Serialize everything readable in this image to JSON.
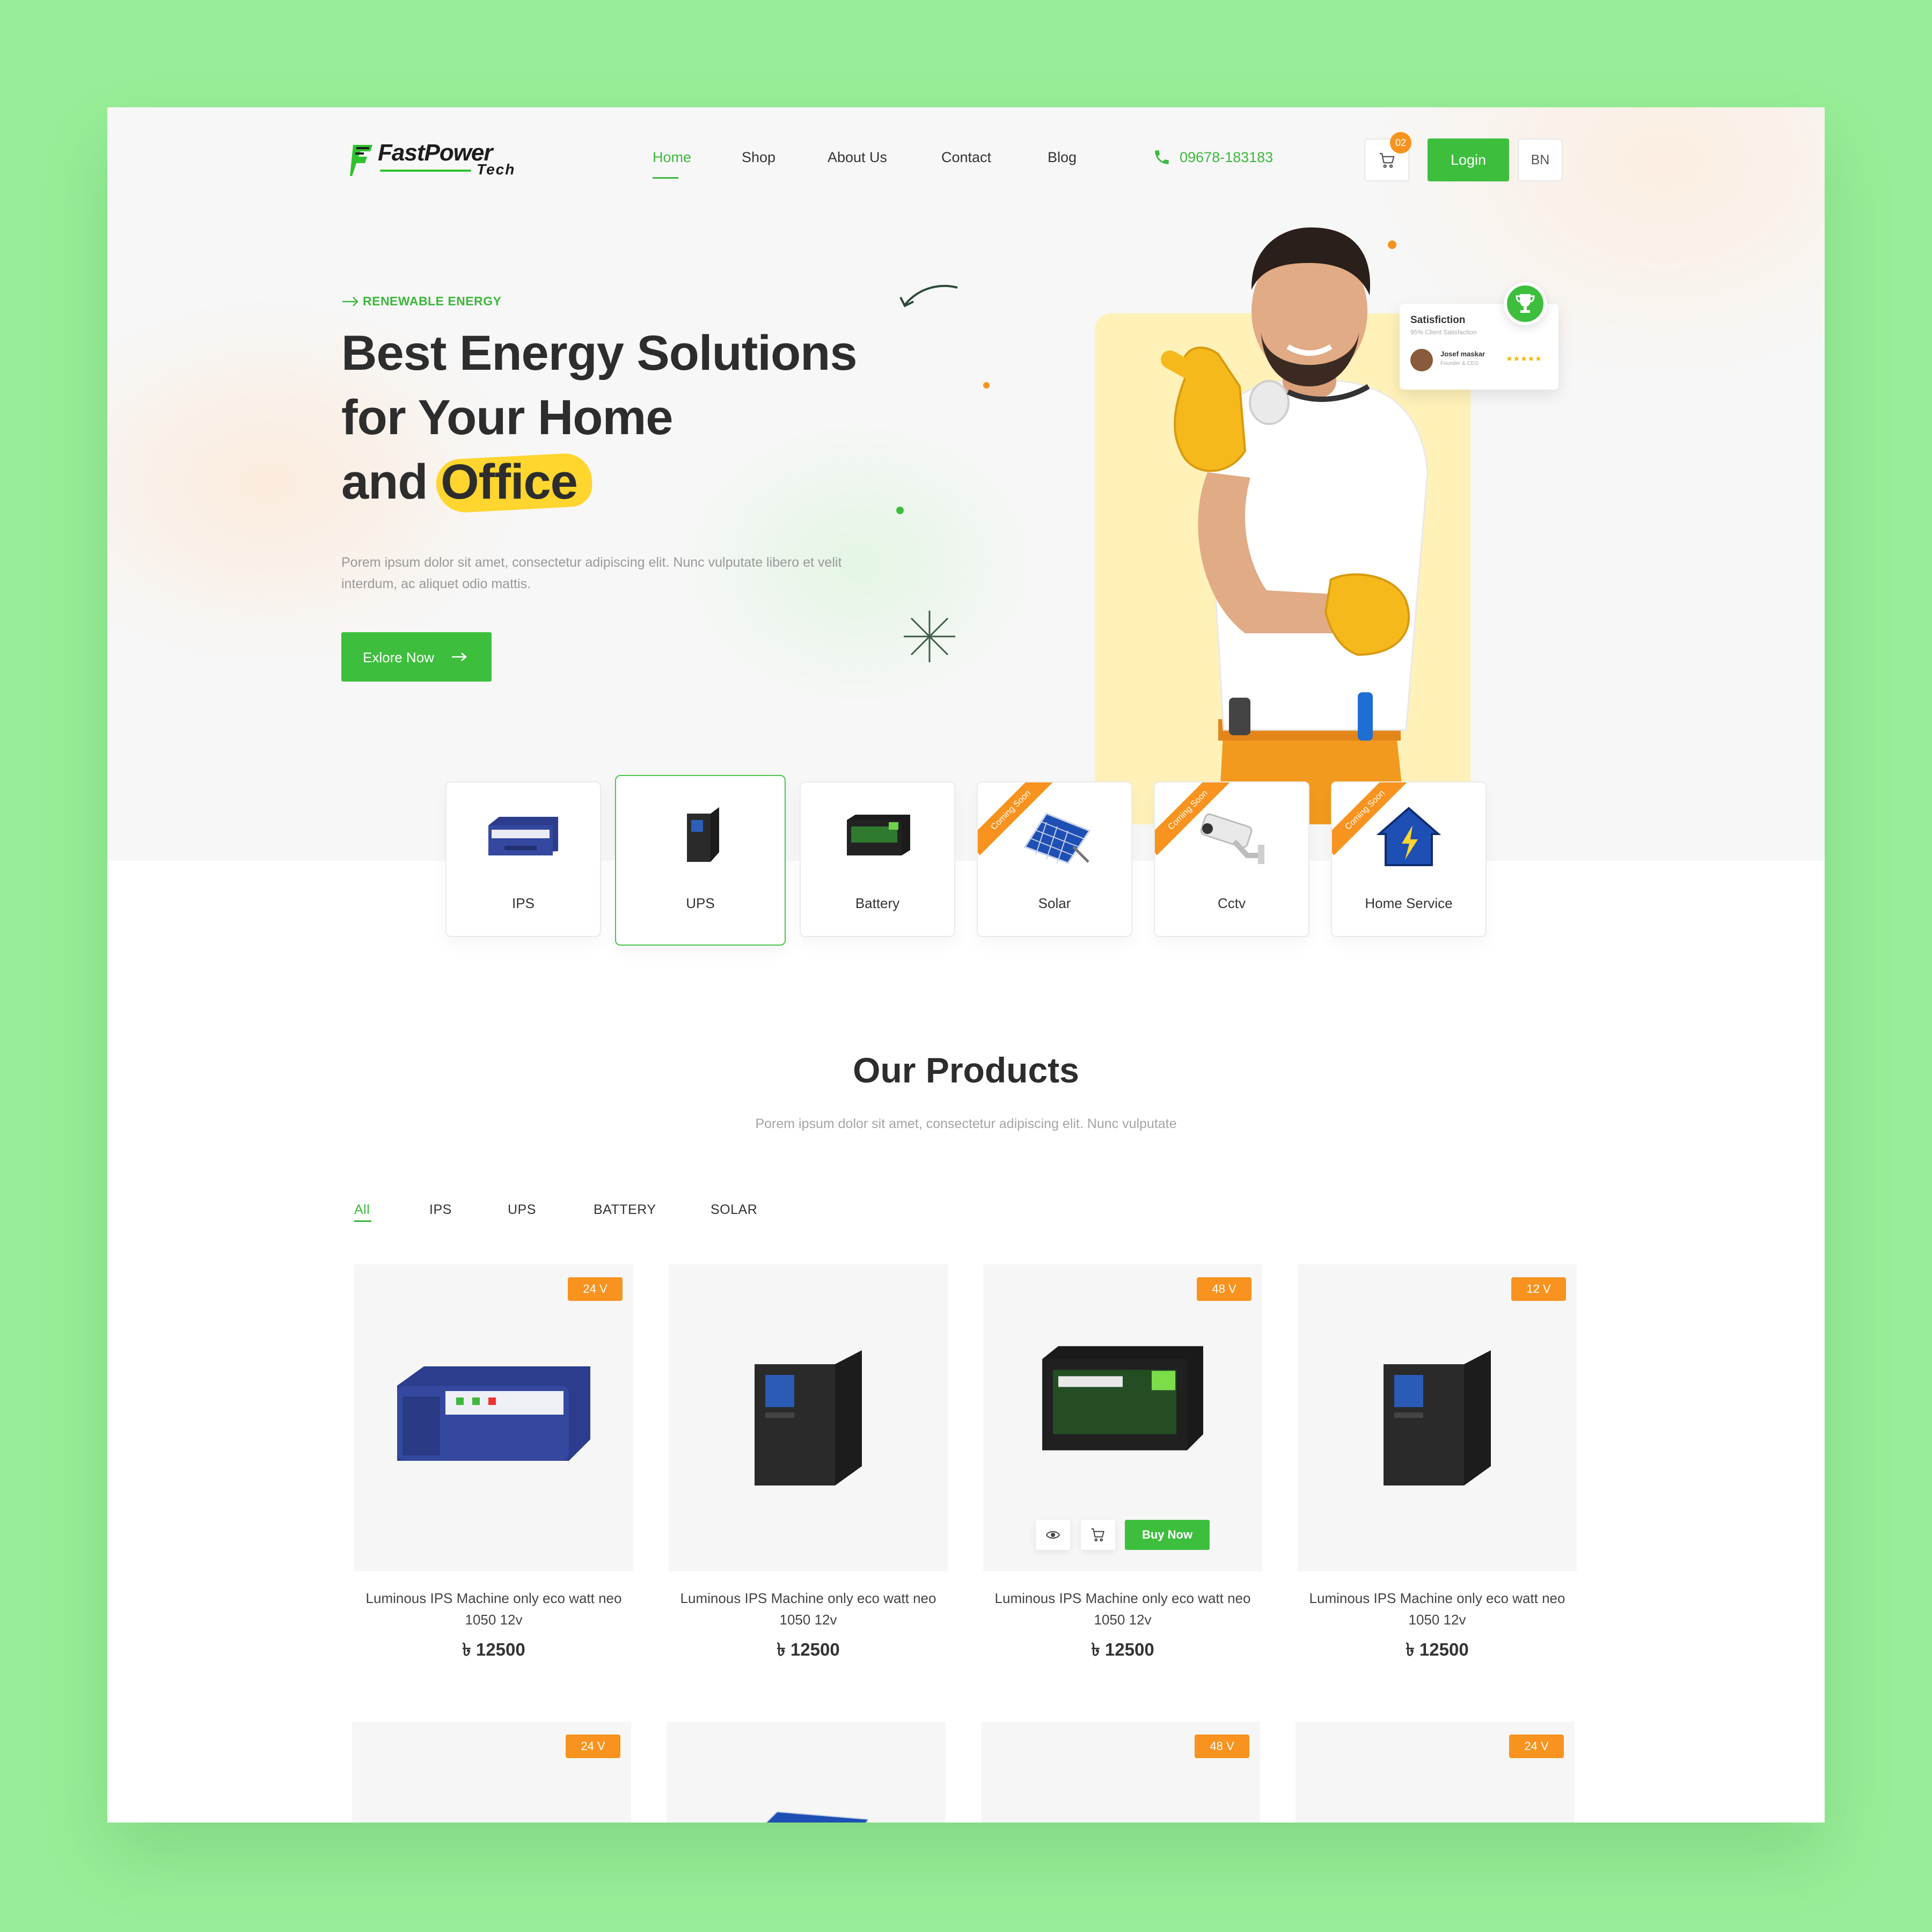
{
  "brand": {
    "name": "FastPower",
    "sub": "Tech"
  },
  "nav": {
    "items": [
      {
        "label": "Home",
        "active": true
      },
      {
        "label": "Shop"
      },
      {
        "label": "About Us"
      },
      {
        "label": "Contact"
      },
      {
        "label": "Blog"
      }
    ],
    "phone": "09678-183183",
    "cart_count": "02",
    "login": "Login",
    "lang": "BN"
  },
  "hero": {
    "eyebrow": "RENEWABLE ENERGY",
    "title_line1": "Best Energy Solutions",
    "title_line2": "for Your Home",
    "title_line3_prefix": "and ",
    "title_highlight": "Office",
    "description": "Porem ipsum dolor sit amet, consectetur adipiscing elit. Nunc vulputate libero et velit interdum, ac aliquet odio mattis.",
    "cta": "Exlore Now",
    "satisfaction": {
      "title": "Satisfiction",
      "subtitle": "95% Client Satisfaction",
      "name": "Josef maskar",
      "role": "Founder & CEO",
      "stars": "★★★★★"
    }
  },
  "categories": [
    {
      "label": "IPS",
      "icon": "ips-icon"
    },
    {
      "label": "UPS",
      "icon": "ups-icon",
      "active": true
    },
    {
      "label": "Battery",
      "icon": "battery-icon"
    },
    {
      "label": "Solar",
      "icon": "solar-icon",
      "ribbon": "Coming Soon"
    },
    {
      "label": "Cctv",
      "icon": "cctv-icon",
      "ribbon": "Coming Soon"
    },
    {
      "label": "Home Service",
      "icon": "home-service-icon",
      "ribbon": "Coming Soon"
    }
  ],
  "products_section": {
    "title": "Our Products",
    "subtitle": "Porem ipsum dolor sit amet, consectetur adipiscing elit. Nunc vulputate",
    "filters": [
      {
        "label": "All",
        "active": true
      },
      {
        "label": "IPS"
      },
      {
        "label": "UPS"
      },
      {
        "label": "BATTERY"
      },
      {
        "label": "SOLAR"
      }
    ],
    "hover_actions": {
      "buy": "Buy Now",
      "view_icon": "eye-icon",
      "cart_icon": "cart-icon"
    },
    "products": [
      {
        "volt": "24 V",
        "title": "Luminous IPS Machine only eco watt neo 1050 12v",
        "price": "৳ 12500",
        "kind": "ips"
      },
      {
        "volt": "",
        "title": "Luminous IPS Machine only eco watt neo 1050 12v",
        "price": "৳ 12500",
        "kind": "ups"
      },
      {
        "volt": "48 V",
        "title": "Luminous IPS Machine only eco watt neo 1050 12v",
        "price": "৳ 12500",
        "kind": "battery"
      },
      {
        "volt": "12 V",
        "title": "Luminous IPS Machine only eco watt neo 1050 12v",
        "price": "৳ 12500",
        "kind": "ups"
      },
      {
        "volt": "24 V",
        "kind": "blank"
      },
      {
        "volt": "",
        "kind": "solar"
      },
      {
        "volt": "48 V",
        "kind": "blank"
      },
      {
        "volt": "24 V",
        "kind": "blank"
      }
    ]
  },
  "colors": {
    "accent": "#3dbf3d",
    "orange": "#f7931e",
    "highlight": "#ffd52e",
    "page_bg": "#98ee98"
  }
}
